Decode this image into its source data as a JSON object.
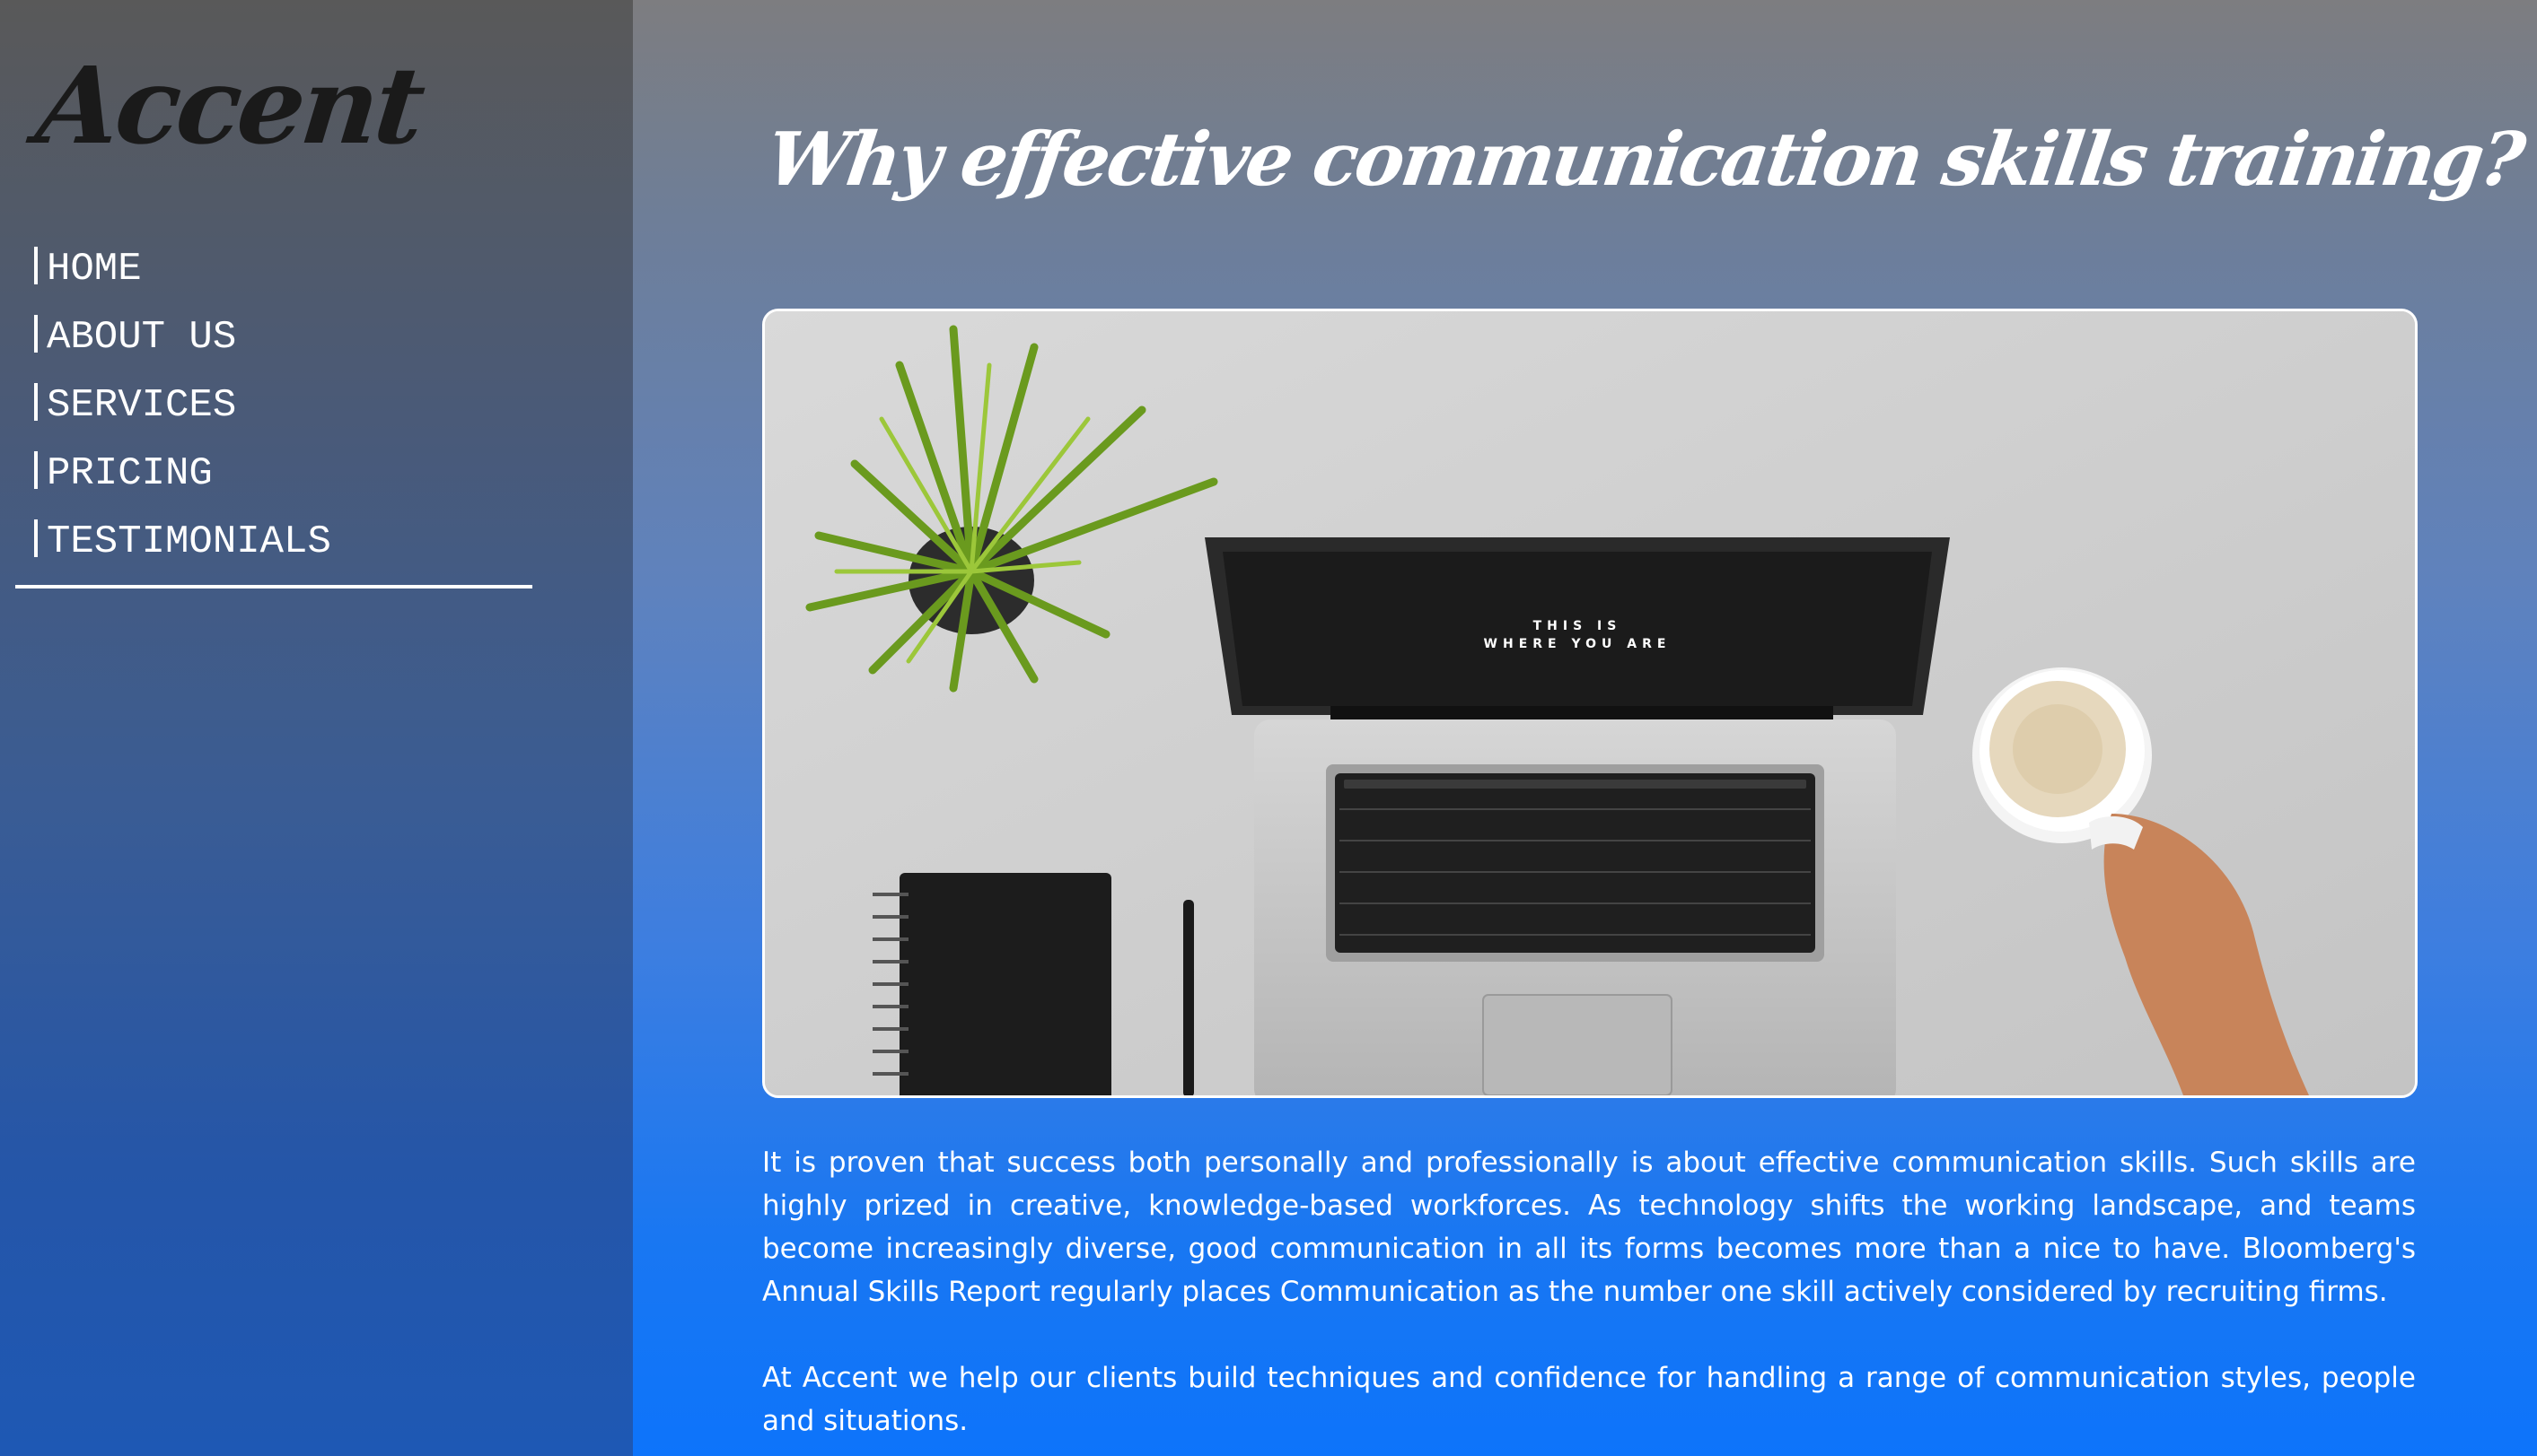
{
  "brand": {
    "logo_text": "Accent"
  },
  "nav": {
    "items": [
      {
        "label": "HOME"
      },
      {
        "label": "ABOUT US"
      },
      {
        "label": "SERVICES"
      },
      {
        "label": "PRICING"
      },
      {
        "label": "TESTIMONIALS"
      }
    ]
  },
  "main": {
    "headline": "Why effective communication skills training?",
    "hero": {
      "screen_line1": "THIS IS",
      "screen_line2": "WHERE YOU ARE"
    },
    "paragraphs": [
      "It is proven that success both personally and professionally is about effective communication skills. Such skills are highly prized in creative, knowledge-based workforces. As technology shifts the working landscape, and teams become increasingly diverse, good communication in all its forms becomes more than a nice to have. Bloomberg's Annual Skills Report regularly places Communication as the number one skill actively considered by recruiting firms.",
      "At Accent we help our clients build techniques and confidence for handling a range of communication styles, people and situations."
    ]
  },
  "colors": {
    "sidebar_top": "#595959",
    "sidebar_bottom": "#1e58b4",
    "main_top": "#7d7d80",
    "main_bottom": "#0d74fb",
    "text": "#ffffff"
  }
}
